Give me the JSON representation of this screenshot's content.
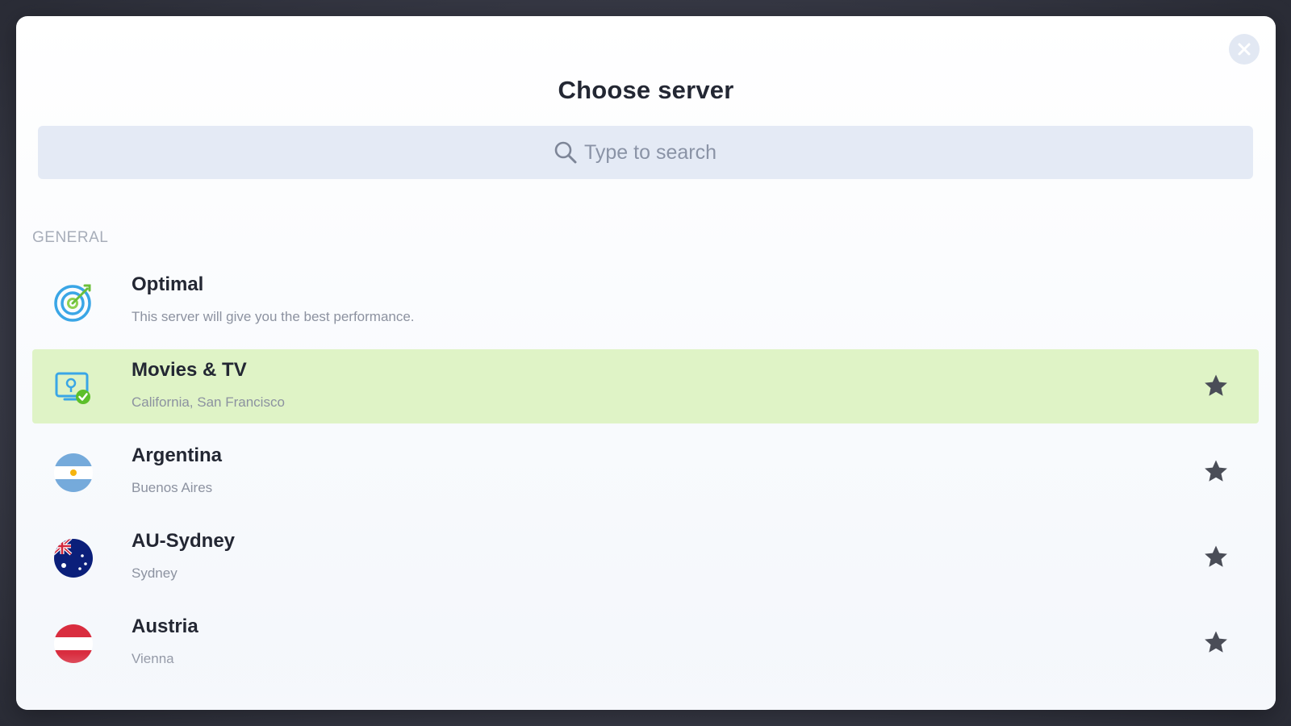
{
  "dialog": {
    "title": "Choose server",
    "close_icon": "close-icon"
  },
  "search": {
    "placeholder": "Type to search",
    "value": "",
    "icon": "search-icon"
  },
  "sections": [
    {
      "label": "GENERAL",
      "items": [
        {
          "name": "Optimal",
          "subtitle": "This server will give you the best performance.",
          "icon": "target-icon",
          "favorite_star": false,
          "selected": false
        },
        {
          "name": "Movies & TV",
          "subtitle": "California, San Francisco",
          "icon": "streaming-screen-icon",
          "favorite_star": true,
          "selected": true,
          "highlight_color": "#dff3c6"
        },
        {
          "name": "Argentina",
          "subtitle": "Buenos Aires",
          "icon": "argentina-flag-icon",
          "favorite_star": true,
          "selected": false
        },
        {
          "name": "AU-Sydney",
          "subtitle": "Sydney",
          "icon": "australia-flag-icon",
          "favorite_star": true,
          "selected": false
        },
        {
          "name": "Austria",
          "subtitle": "Vienna",
          "icon": "austria-flag-icon",
          "favorite_star": true,
          "selected": false
        }
      ]
    }
  ],
  "colors": {
    "selected_row": "#dff3c6",
    "search_bg": "#e4eaf5",
    "star": "#4a4d57"
  }
}
